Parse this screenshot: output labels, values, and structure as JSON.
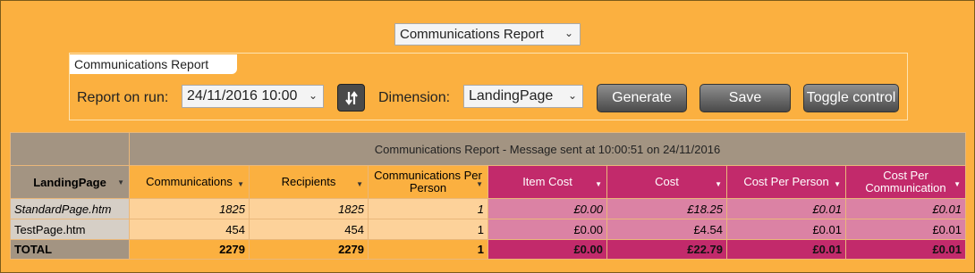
{
  "report_selector": {
    "value": "Communications Report"
  },
  "panel": {
    "legend": "Communications Report",
    "run_label": "Report on run:",
    "run_value": "24/11/2016 10:00",
    "dimension_label": "Dimension:",
    "dimension_value": "LandingPage",
    "generate_label": "Generate",
    "save_label": "Save",
    "toggle_label": "Toggle control"
  },
  "table": {
    "title": "Communications Report - Message sent at 10:00:51 on 24/11/2016",
    "dimension_header": "LandingPage",
    "columns": [
      "Communications",
      "Recipients",
      "Communications Per Person",
      "Item Cost",
      "Cost",
      "Cost Per Person",
      "Cost Per Communication"
    ],
    "rows": [
      {
        "name": "StandardPage.htm",
        "values": [
          "1825",
          "1825",
          "1",
          "£0.00",
          "£18.25",
          "£0.01",
          "£0.01"
        ]
      },
      {
        "name": "TestPage.htm",
        "values": [
          "454",
          "454",
          "1",
          "£0.00",
          "£4.54",
          "£0.01",
          "£0.01"
        ]
      }
    ],
    "total": {
      "name": "TOTAL",
      "values": [
        "2279",
        "2279",
        "1",
        "£0.00",
        "£22.79",
        "£0.01",
        "£0.01"
      ]
    }
  },
  "colors": {
    "background": "#fbb040",
    "header_orange": "#fbb040",
    "header_pink": "#c22a6b",
    "cell_orange": "#fdd29a",
    "cell_pink": "#db82a4",
    "dimension_grey": "#a39482"
  }
}
